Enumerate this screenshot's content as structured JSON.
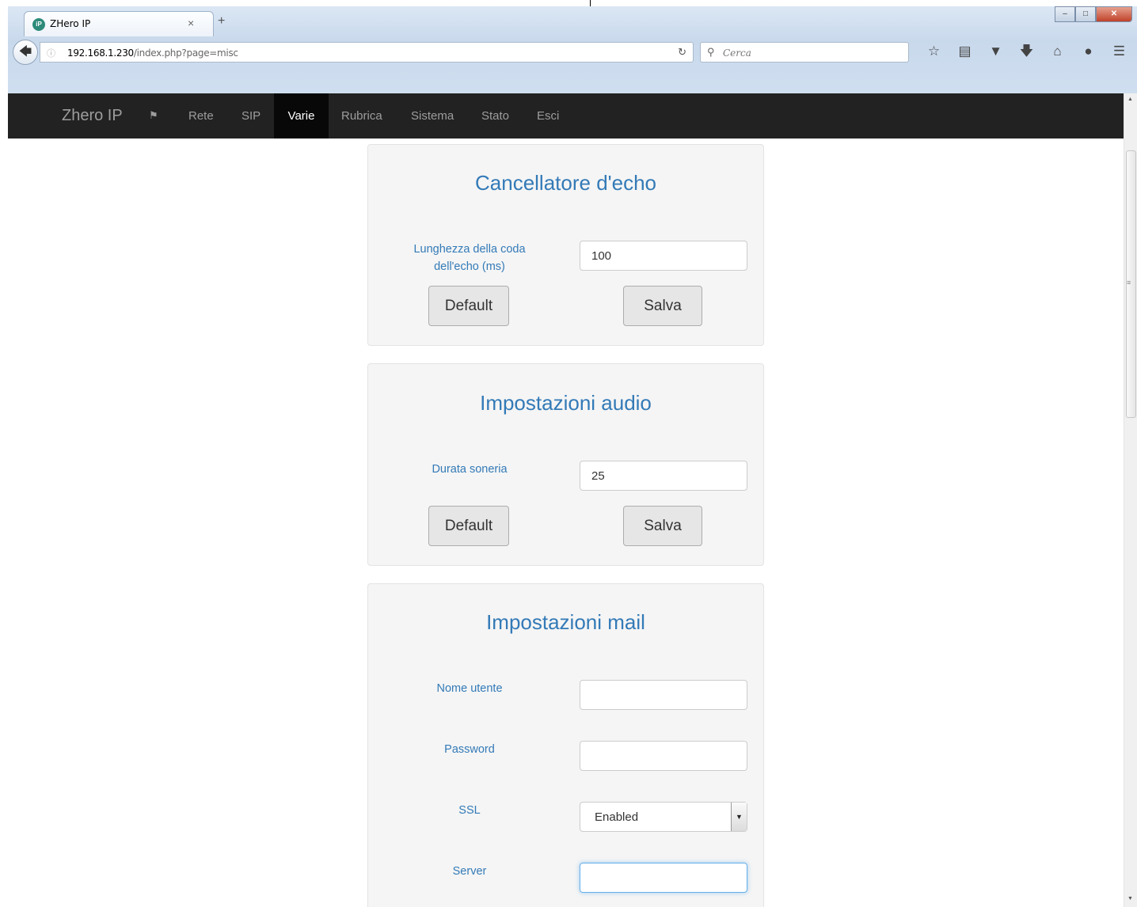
{
  "browser": {
    "tab_title": "ZHero IP",
    "tab_favicon": "iP",
    "tab_close": "×",
    "new_tab": "+",
    "url_host": "192.168.1.230",
    "url_path": "/index.php?page=misc",
    "search_placeholder": "Cerca",
    "toolbar_icons": [
      "star-icon",
      "reading-list-icon",
      "pocket-icon",
      "download-icon",
      "home-icon",
      "chat-icon",
      "menu-icon"
    ]
  },
  "navbar": {
    "brand": "Zhero IP",
    "items": [
      "Rete",
      "SIP",
      "Varie",
      "Rubrica",
      "Sistema",
      "Stato",
      "Esci"
    ],
    "active": "Varie"
  },
  "echo": {
    "title": "Cancellatore d'echo",
    "tail_label_1": "Lunghezza della coda",
    "tail_label_2": "dell'echo (ms)",
    "tail_value": "100",
    "default_label": "Default",
    "save_label": "Salva"
  },
  "audio": {
    "title": "Impostazioni audio",
    "ring_label": "Durata soneria",
    "ring_value": "25",
    "default_label": "Default",
    "save_label": "Salva"
  },
  "mail": {
    "title": "Impostazioni mail",
    "username_label": "Nome utente",
    "username_value": "",
    "password_label": "Password",
    "password_value": "",
    "ssl_label": "SSL",
    "ssl_value": "Enabled",
    "server_label": "Server",
    "server_value": ""
  },
  "colors": {
    "accent": "#337ab7",
    "navbar": "#222222",
    "navbar_active": "#080808"
  }
}
